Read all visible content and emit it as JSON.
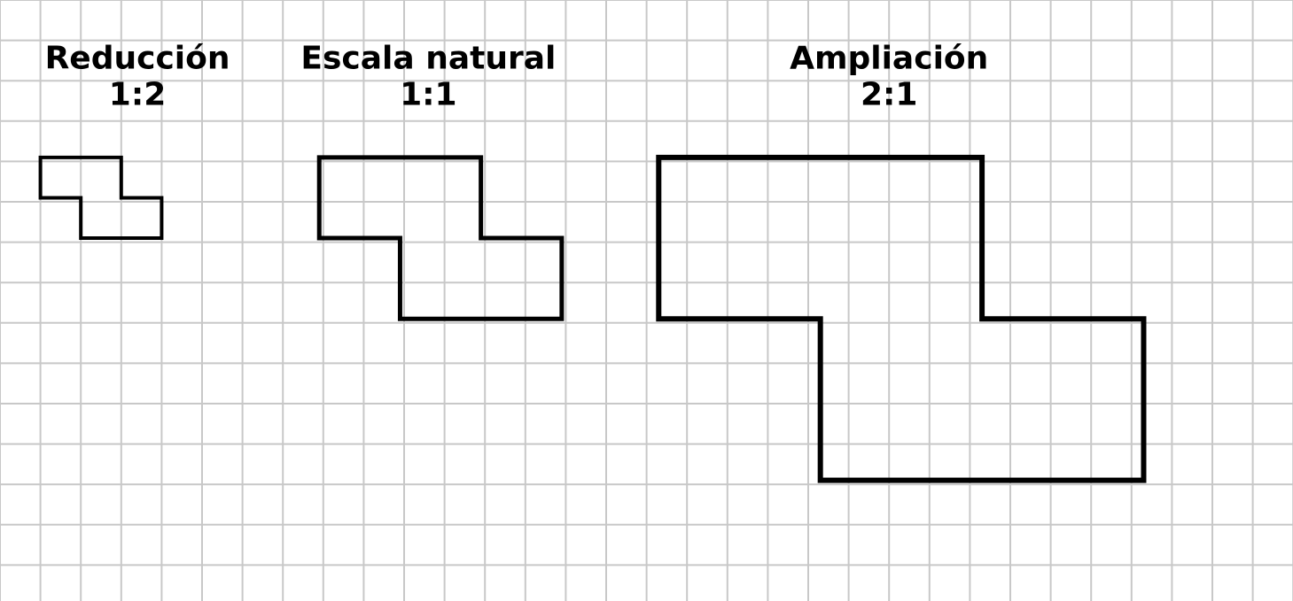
{
  "grid": {
    "cell": 45.6,
    "cols": 32,
    "rows": 15,
    "color": "#c8c8c8",
    "stroke_width": 2
  },
  "labels": {
    "reduction": {
      "title": "Reducción",
      "ratio": "1:2",
      "cx_cells": 3.4
    },
    "natural": {
      "title": "Escala natural",
      "ratio": "1:1",
      "cx_cells": 10.6
    },
    "enlarge": {
      "title": "Ampliación",
      "ratio": "2:1",
      "cx_cells": 22.0
    }
  },
  "shapes": {
    "reduction": {
      "origin_cells": [
        1.0,
        3.9
      ],
      "scale": 0.5,
      "stroke_width": 4
    },
    "natural": {
      "origin_cells": [
        7.9,
        3.9
      ],
      "scale": 1.0,
      "stroke_width": 5
    },
    "enlarge": {
      "origin_cells": [
        16.3,
        3.9
      ],
      "scale": 2.0,
      "stroke_width": 6
    }
  },
  "base_polygon_cells": [
    [
      0,
      0
    ],
    [
      4,
      0
    ],
    [
      4,
      2
    ],
    [
      6,
      2
    ],
    [
      6,
      4
    ],
    [
      2,
      4
    ],
    [
      2,
      2
    ],
    [
      0,
      2
    ]
  ],
  "colors": {
    "shape_stroke": "#000000"
  }
}
